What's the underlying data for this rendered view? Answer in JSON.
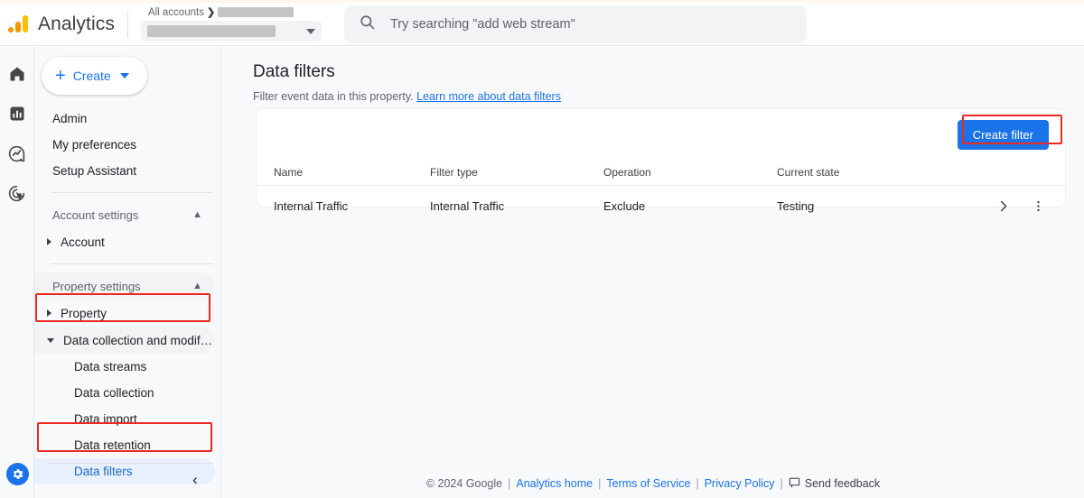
{
  "header": {
    "brand": "Analytics",
    "logo_icon": "google-analytics-logo",
    "account_breadcrumb": "All accounts",
    "breadcrumb_chevron": "❯",
    "account_name_redacted": "",
    "property_name_redacted": "",
    "search": {
      "icon": "search-icon",
      "placeholder": "Try searching \"add web stream\""
    }
  },
  "rail": {
    "items": [
      {
        "name": "home-icon",
        "label": "Home"
      },
      {
        "name": "reports-icon",
        "label": "Reports"
      },
      {
        "name": "explore-icon",
        "label": "Explore"
      },
      {
        "name": "advertising-icon",
        "label": "Advertising"
      }
    ],
    "settings_icon": "gear-icon"
  },
  "sidebar": {
    "create_button": {
      "icon": "plus-icon",
      "label": "Create",
      "caret": "caret-down-icon"
    },
    "items": [
      {
        "label": "Admin"
      },
      {
        "label": "My preferences"
      },
      {
        "label": "Setup Assistant"
      }
    ],
    "account_settings": {
      "label": "Account settings",
      "collapse_icon": "chevron-up-icon"
    },
    "account_group": {
      "label": "Account",
      "expander": "triangle-right-icon"
    },
    "property_settings": {
      "label": "Property settings",
      "collapse_icon": "chevron-up-icon"
    },
    "property_group": {
      "label": "Property",
      "expander": "triangle-right-icon"
    },
    "data_group": {
      "label": "Data collection and modifica…",
      "expander": "triangle-down-icon"
    },
    "data_children": [
      {
        "label": "Data streams",
        "active": false
      },
      {
        "label": "Data collection",
        "active": false
      },
      {
        "label": "Data import",
        "active": false
      },
      {
        "label": "Data retention",
        "active": false
      },
      {
        "label": "Data filters",
        "active": true
      }
    ],
    "collapse_control": {
      "icon": "chevron-left-icon",
      "label": "‹"
    }
  },
  "main": {
    "title": "Data filters",
    "subtitle_text": "Filter event data in this property.",
    "subtitle_link": "Learn more about data filters",
    "create_filter_label": "Create filter",
    "table": {
      "columns": [
        "Name",
        "Filter type",
        "Operation",
        "Current state"
      ],
      "rows": [
        {
          "name": "Internal Traffic",
          "filter_type": "Internal Traffic",
          "operation": "Exclude",
          "current_state": "Testing",
          "open_icon": "chevron-right-icon",
          "menu_icon": "more-vert-icon"
        }
      ]
    }
  },
  "footer": {
    "copyright": "© 2024 Google",
    "links": [
      "Analytics home",
      "Terms of Service",
      "Privacy Policy"
    ],
    "feedback_label": "Send feedback",
    "feedback_icon": "feedback-icon",
    "separator": "|"
  },
  "colors": {
    "accent_blue": "#1a73e8",
    "annotation_red": "#ea2a20",
    "selected_nav_bg": "#e8f0fe",
    "page_bg": "#f8f9fa",
    "logo_orange": "#f29900",
    "logo_amber": "#fbbc04"
  }
}
